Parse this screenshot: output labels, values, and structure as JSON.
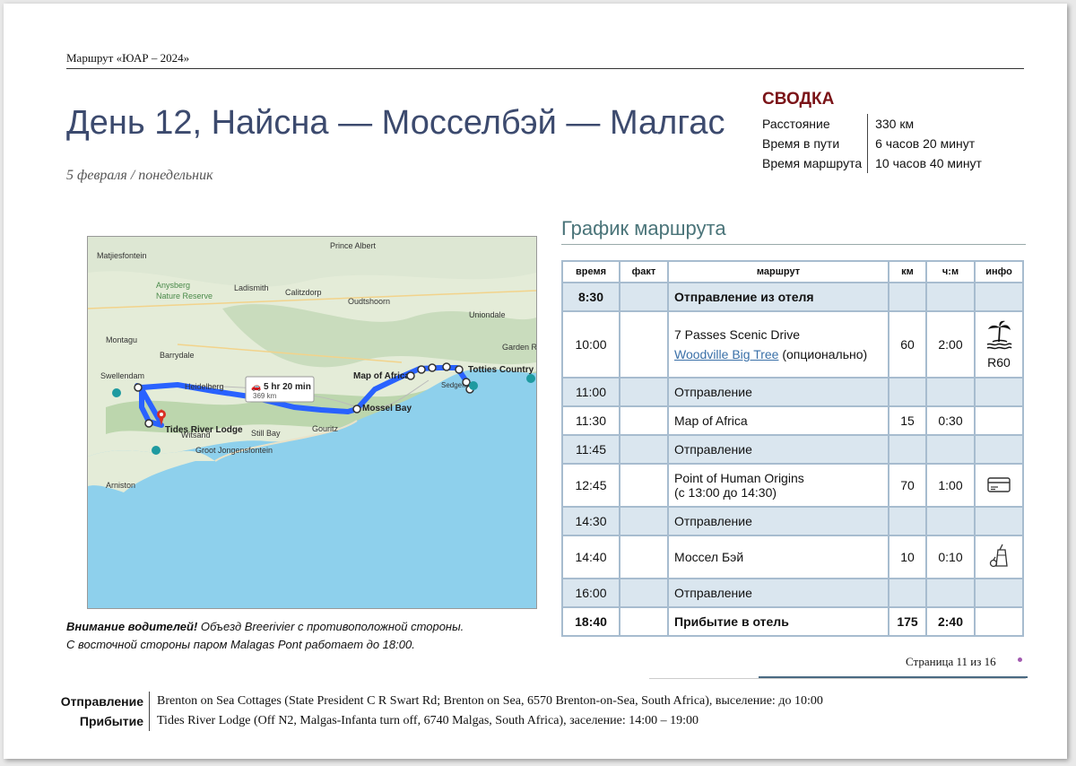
{
  "header": {
    "doc_title": "Маршрут «ЮАР – 2024»"
  },
  "title": "День 12, Найсна — Мосселбэй — Малгас",
  "subtitle": "5 февраля / понедельник",
  "summary": {
    "heading": "СВОДКА",
    "rows": [
      {
        "label": "Расстояние",
        "value": "330 км"
      },
      {
        "label": "Время в пути",
        "value": "6 часов 20 минут"
      },
      {
        "label": "Время маршрута",
        "value": "10 часов 40 минут"
      }
    ]
  },
  "schedule": {
    "heading": "График маршрута",
    "columns": [
      "время",
      "факт",
      "маршрут",
      "км",
      "ч:м",
      "инфо"
    ],
    "rows": [
      {
        "time": "8:30",
        "route": "Отправление из отеля",
        "km": "",
        "dur": ""
      },
      {
        "time": "10:00",
        "route": "7 Passes Scenic Drive",
        "link": "Woodville Big Tree",
        "extra": " (опционально)",
        "km": "60",
        "dur": "2:00",
        "info_icon": "beach-palm-icon",
        "info_text": "R60"
      },
      {
        "time": "11:00",
        "route": "Отправление",
        "km": "",
        "dur": ""
      },
      {
        "time": "11:30",
        "route": "Map of Africa",
        "km": "15",
        "dur": "0:30"
      },
      {
        "time": "11:45",
        "route": "Отправление",
        "km": "",
        "dur": ""
      },
      {
        "time": "12:45",
        "route": "Point of Human Origins",
        "route2": "(с 13:00 до 14:30)",
        "km": "70",
        "dur": "1:00",
        "info_icon": "credit-card-icon"
      },
      {
        "time": "14:30",
        "route": "Отправление",
        "km": "",
        "dur": ""
      },
      {
        "time": "14:40",
        "route": "Моссел Бэй",
        "km": "10",
        "dur": "0:10",
        "info_icon": "food-drink-icon"
      },
      {
        "time": "16:00",
        "route": "Отправление",
        "km": "",
        "dur": ""
      },
      {
        "time": "18:40",
        "route": "Прибытие в отель",
        "km": "175",
        "dur": "2:40"
      }
    ]
  },
  "map": {
    "labels": {
      "ladismith": "Ladismith",
      "calitzdorp": "Calitzdorp",
      "oudtshoorn": "Oudtshoorn",
      "prince_albert": "Prince Albert",
      "anysberg": "Anysberg",
      "nature_reserve": "Nature Reserve",
      "matjiesfontein": "Matjiesfontein",
      "montagu": "Montagu",
      "barrydale": "Barrydale",
      "swellendam": "Swellendam",
      "heidelberg": "Heidelberg",
      "witsand": "Witsand",
      "arniston": "Arniston",
      "still_bay": "Still Bay",
      "gouritz": "Gouritz",
      "groot_jongensfontein": "Groot Jongensfontein",
      "uniondale": "Uniondale",
      "sedgefield": "Sedgefield",
      "garden_route": "Garden R",
      "map_of_africa": "Map of Africa",
      "mossel_bay": "Mossel Bay",
      "totties": "Totties Country M",
      "tides": "Tides River Lodge",
      "duration": "5 hr 20 min",
      "distance": "369 km"
    }
  },
  "note": {
    "warn": "Внимание водителей!",
    "line1": " Объезд Breerivier с противоположной стороны.",
    "line2": "С восточной стороны паром Malagas Pont работает до 18:00."
  },
  "page": {
    "label": "Страница 11 из 16"
  },
  "footer": {
    "departure_label": "Отправление",
    "departure": "Brenton on Sea Cottages (State President C R Swart Rd; Brenton on Sea, 6570 Brenton-on-Sea, South Africa), выселение: до 10:00",
    "arrival_label": "Прибытие",
    "arrival": "Tides River Lodge (Off N2, Malgas-Infanta turn off, 6740 Malgas, South Africa), заселение: 14:00 – 19:00"
  },
  "colors": {
    "title": "#3c4a6e",
    "summary_heading": "#7b1418",
    "table_alt": "#dae6ef",
    "route_line": "#2962ff"
  }
}
